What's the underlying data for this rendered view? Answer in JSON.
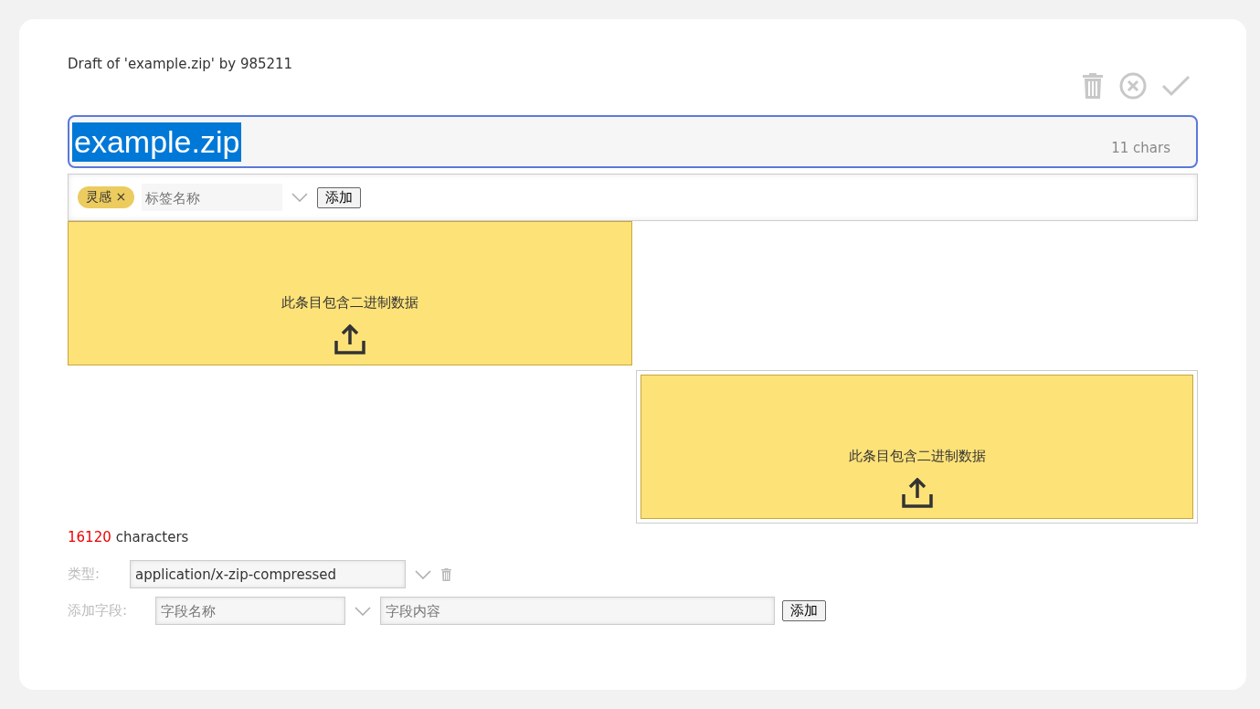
{
  "header": {
    "text": "Draft of 'example.zip' by 985211"
  },
  "title": {
    "value": "example.zip",
    "selected": true,
    "counter": "11 chars"
  },
  "tags": {
    "items": [
      {
        "label": "灵感",
        "remove": "×"
      }
    ],
    "placeholder": "标签名称",
    "add_button": "添加"
  },
  "panels": [
    {
      "message": "此条目包含二进制数据",
      "framed": false
    },
    {
      "message": "此条目包含二进制数据",
      "framed": true
    }
  ],
  "length": {
    "count": "16120",
    "label": "characters"
  },
  "type_field": {
    "label": "类型:",
    "value": "application/x-zip-compressed"
  },
  "add_field": {
    "label": "添加字段:",
    "name_placeholder": "字段名称",
    "content_placeholder": "字段内容",
    "add_button": "添加"
  }
}
